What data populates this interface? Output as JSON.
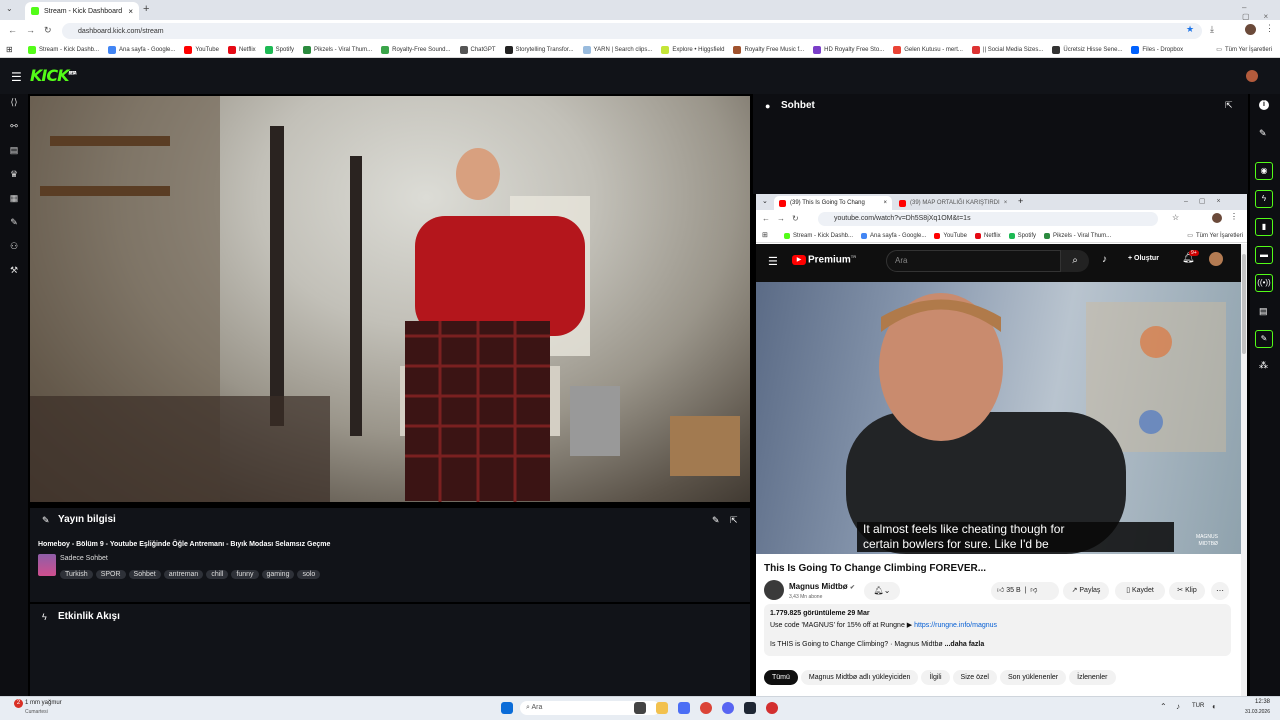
{
  "browser": {
    "tab_title": "Stream - Kick Dashboard",
    "url": "dashboard.kick.com/stream",
    "bookmarks": [
      "Stream - Kick Dashb...",
      "Ana sayfa - Google...",
      "YouTube",
      "Netflix",
      "Spotify",
      "Pikzels - Viral Thum...",
      "Royalty-Free Sound...",
      "ChatGPT",
      "Storytelling Transfor...",
      "YARN | Search clips...",
      "Explore • Higgsfield",
      "Royalty Free Music f...",
      "HD Royalty Free Sto...",
      "Gelen Kutusu - mert...",
      "|| Social Media Sizes...",
      "Ücretsiz Hisse Sene...",
      "Files - Dropbox"
    ],
    "all_bookmarks": "Tüm Yer İşaretleri"
  },
  "kick": {
    "logo": "KICK",
    "logo_sup": "BETA",
    "chat_title": "Sohbet",
    "stream_info": {
      "title": "Yayın bilgisi",
      "stream_title": "Homeboy - Bölüm 9 - Youtube Eşliğinde Öğle Antremanı - Bıyık Modası Selamsız Geçme",
      "category": "Sadece Sohbet",
      "tags": [
        "Turkish",
        "SPOR",
        "Sohbet",
        "antreman",
        "chill",
        "funny",
        "gaming",
        "solo"
      ]
    },
    "activity_title": "Etkinlik Akışı"
  },
  "yt": {
    "tab1": "(39) This Is Going To Chang",
    "tab2": "(39) MAP ORTALIĞI KARIŞTIRDI",
    "url": "youtube.com/watch?v=Dh5S8jXq1OM&t=1s",
    "bookmarks": [
      "Stream - Kick Dashb...",
      "Ana sayfa - Google...",
      "YouTube",
      "Netflix",
      "Spotify",
      "Pikzels - Viral Thum..."
    ],
    "all_bookmarks": "Tüm Yer İşaretleri",
    "logo": "Premium",
    "logo_sup": "TR",
    "search_placeholder": "Ara",
    "create": "Oluştur",
    "notif": "9+",
    "caption_line1": "It almost feels like cheating though for",
    "caption_line2": "certain bowlers for sure. Like I'd be",
    "watermark_line1": "MAGNUS",
    "watermark_line2": "MIDTBØ",
    "video_title": "This Is Going To Change Climbing FOREVER...",
    "channel": "Magnus Midtbø",
    "subs": "3,43 Mn abone",
    "likes": "35 B",
    "share": "Paylaş",
    "save": "Kaydet",
    "clip": "Klip",
    "views": "1.779.825 görüntüleme  29 Mar",
    "desc1": "Use code 'MAGNUS' for 15% off at Rungne ▶",
    "desc_link": "https://rungne.info/magnus",
    "desc2": "Is THIS is Going to Change Climbing? · Magnus Midtbø",
    "more": "...daha fazla",
    "chips": [
      "Tümü",
      "Magnus Midtbø adlı yükleyiciden",
      "İlgili",
      "Size özel",
      "Son yüklenenler",
      "İzlenenler"
    ]
  },
  "taskbar": {
    "weather_badge": "2",
    "weather": "1 mm yağmur",
    "weather_sub": "Cumartesi",
    "search": "Ara",
    "lang": "TUR",
    "time": "12:38",
    "date": "31.03.2026"
  }
}
